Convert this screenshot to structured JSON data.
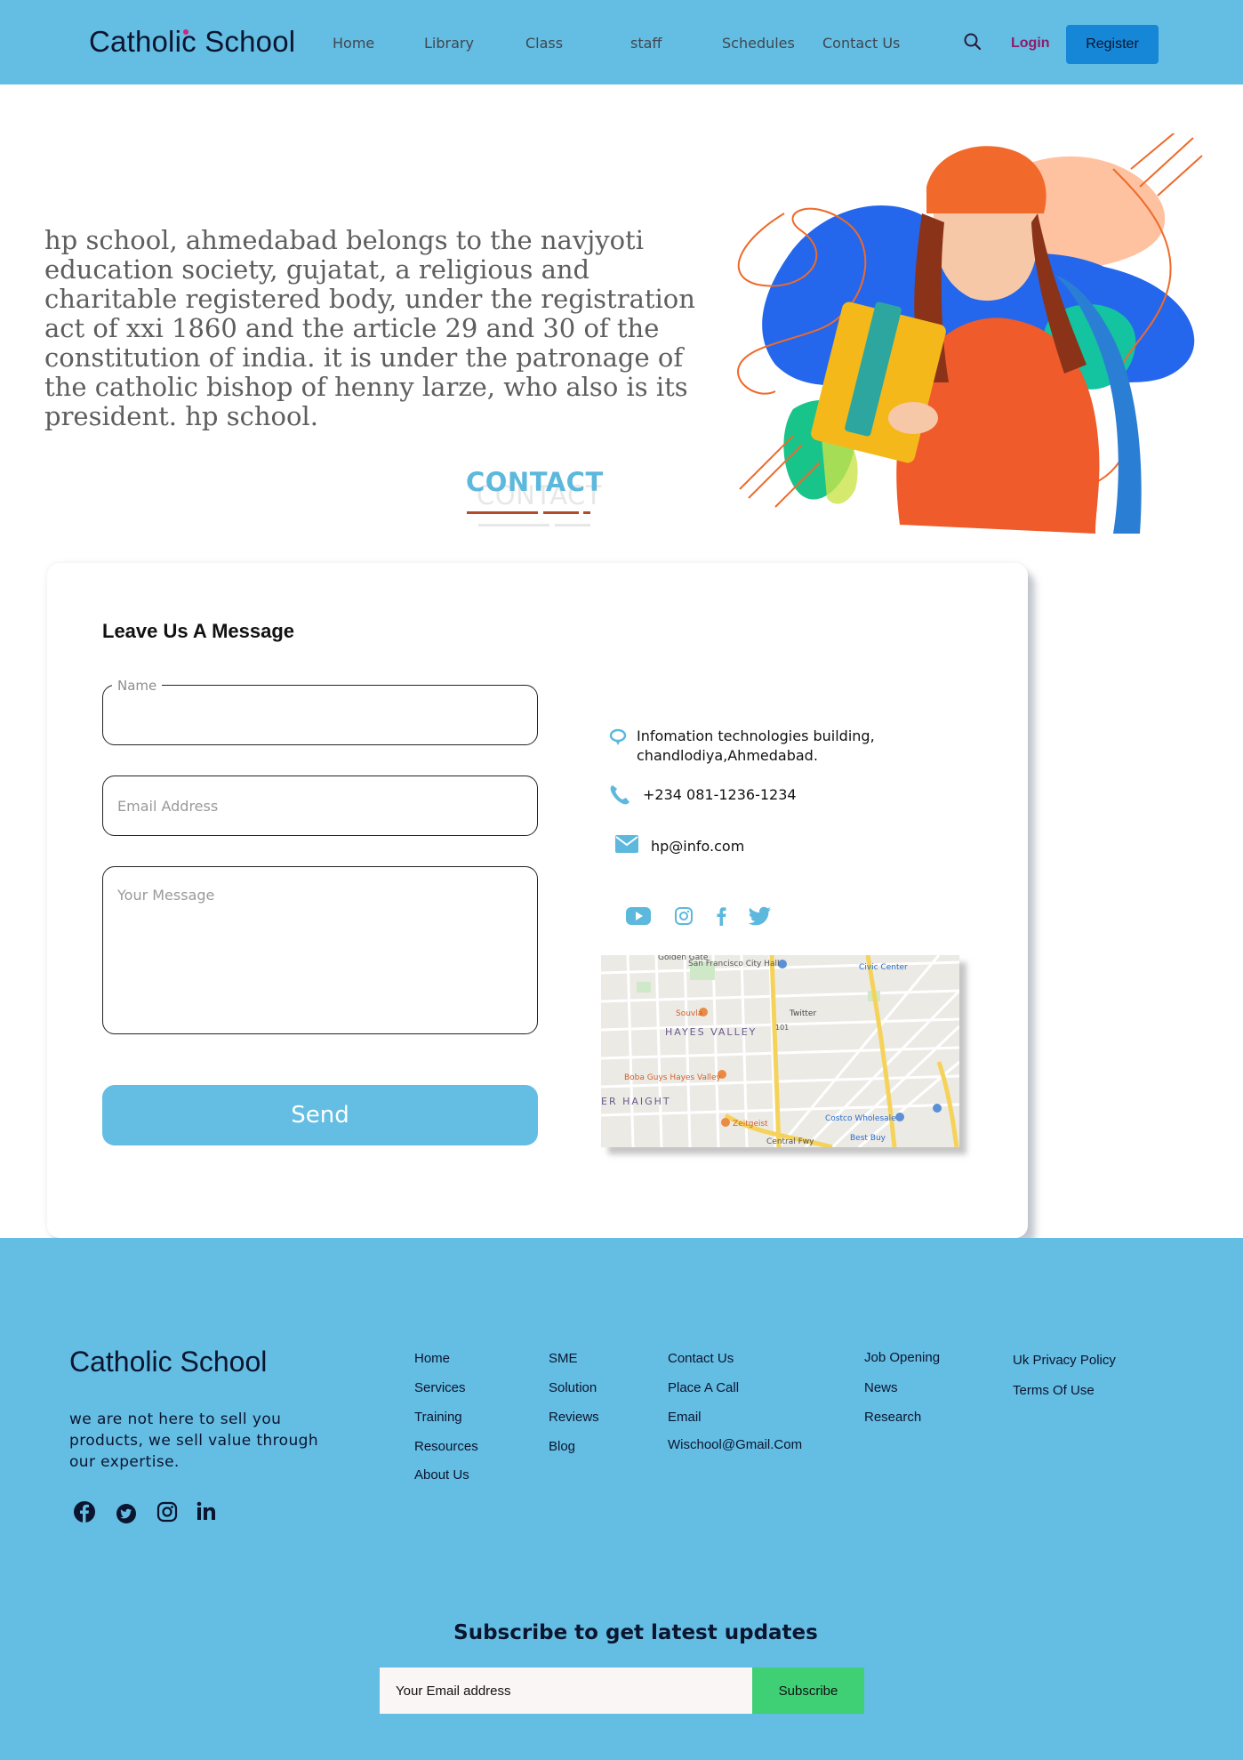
{
  "nav": {
    "logo": "Catholic School",
    "links": [
      "Home",
      "Library",
      "Class",
      "staff",
      "Schedules",
      "Contact Us"
    ],
    "login": "Login",
    "register": "Register"
  },
  "hero": {
    "text": "hp school, ahmedabad belongs to the navjyoti education society, gujatat, a religious and charitable registered body, under the registration act of xxi 1860 and the article 29 and 30 of the constitution of india. it is under the patronage of the catholic bishop of henny larze, who also is its president. hp school."
  },
  "contact": {
    "heading": "CONTACT",
    "form_title": "Leave Us A Message",
    "name_label": "Name",
    "email_placeholder": "Email Address",
    "message_placeholder": "Your Message",
    "send": "Send",
    "address_line1": "Infomation technologies building,",
    "address_line2": "chandlodiya,Ahmedabad.",
    "phone": "+234 081-1236-1234",
    "email": "hp@info.com",
    "social_icons": [
      "youtube-icon",
      "instagram-icon",
      "facebook-icon",
      "twitter-icon"
    ],
    "map_labels": [
      "San Francisco City Hall",
      "Golden Gate",
      "Civic Center",
      "Souvla",
      "Twitter",
      "HAYES VALLEY",
      "Boba Guys Hayes Valley",
      "ER HAIGHT",
      "Zeitgeist",
      "Costco Wholesale",
      "Best Buy",
      "Central Fwy",
      "101"
    ]
  },
  "footer": {
    "logo": "Catholic School",
    "tagline": "we are not here to sell you products, we sell value through our expertise.",
    "social_icons": [
      "facebook-icon",
      "twitter-icon",
      "instagram-icon",
      "linkedin-icon"
    ],
    "col1": [
      "Home",
      "Services",
      "Training",
      "Resources",
      "About Us"
    ],
    "col2": [
      "SME",
      "Solution",
      "Reviews",
      "Blog"
    ],
    "col3": [
      "Contact Us",
      "Place A Call",
      "Email",
      "Wischool@Gmail.Com"
    ],
    "col4": [
      "Job Opening",
      "News",
      "Research"
    ],
    "col5": [
      "Uk Privacy Policy",
      "Terms Of Use"
    ],
    "subscribe_title": "Subscribe to get latest updates",
    "subscribe_placeholder": "Your Email address",
    "subscribe_button": "Subscribe"
  },
  "colors": {
    "brand_blue": "#64bde2",
    "register_blue": "#1587d6",
    "login_magenta": "#8b1e6a",
    "subscribe_green": "#3fcf75",
    "heading_underline": "#b24a2c"
  }
}
